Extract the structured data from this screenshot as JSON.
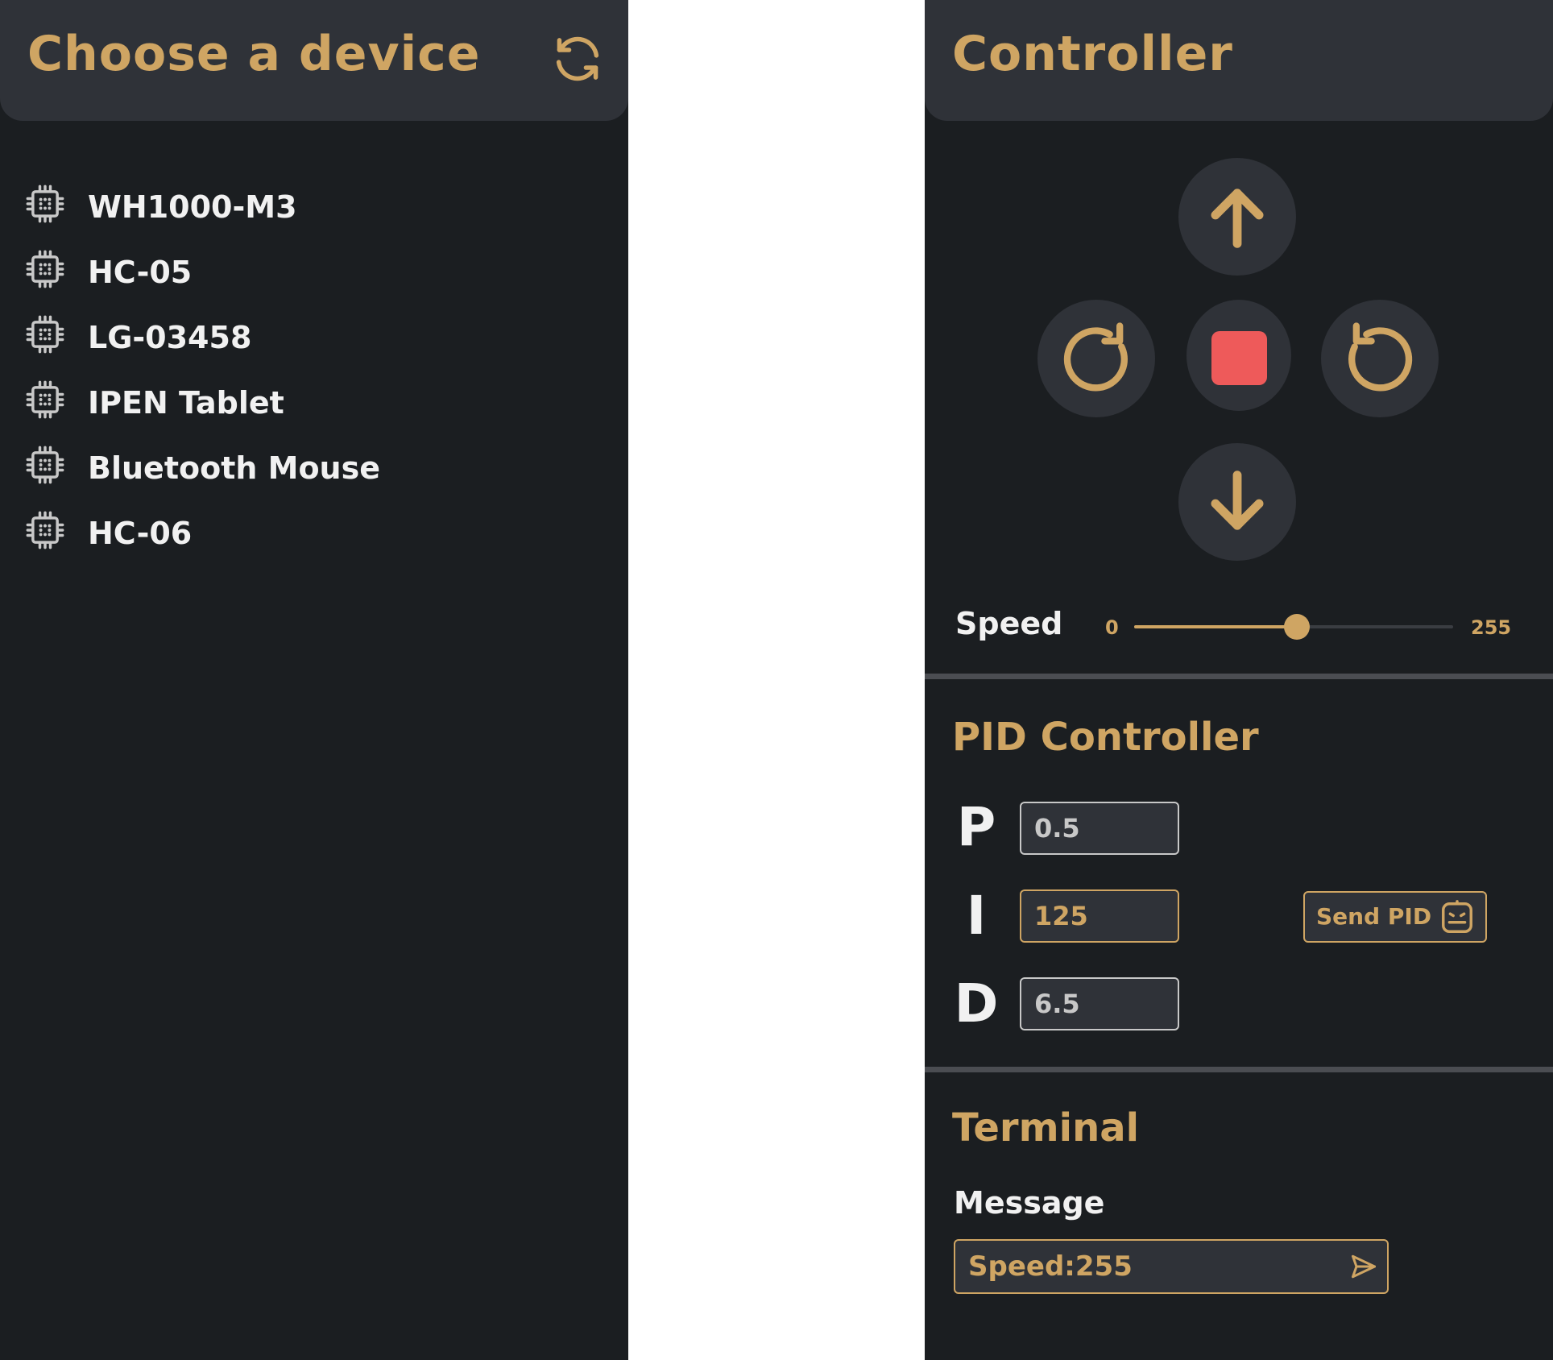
{
  "devices_panel": {
    "title": "Choose a device",
    "refresh_icon": "refresh-icon",
    "devices": [
      {
        "label": "WH1000-M3",
        "icon": "chip-icon"
      },
      {
        "label": "HC-05",
        "icon": "chip-icon"
      },
      {
        "label": "LG-03458",
        "icon": "chip-icon"
      },
      {
        "label": "IPEN Tablet",
        "icon": "chip-icon"
      },
      {
        "label": "Bluetooth Mouse",
        "icon": "chip-icon"
      },
      {
        "label": "HC-06",
        "icon": "chip-icon"
      }
    ]
  },
  "controller_panel": {
    "title": "Controller",
    "buttons": {
      "up": "arrow-up-icon",
      "rotate_cw": "rotate-clockwise-icon",
      "stop": "stop-icon",
      "rotate_ccw": "rotate-counterclockwise-icon",
      "down": "arrow-down-icon"
    },
    "speed": {
      "label": "Speed",
      "min": "0",
      "max": "255",
      "value": 130
    },
    "pid": {
      "title": "PID Controller",
      "p_label": "P",
      "p_value": "0.5",
      "i_label": "I",
      "i_value": "125",
      "d_label": "D",
      "d_value": "6.5",
      "send_label": "Send PID",
      "send_icon": "robot-face-icon"
    },
    "terminal": {
      "title": "Terminal",
      "message_label": "Message",
      "message_value": "Speed:255",
      "send_icon": "send-icon"
    }
  },
  "colors": {
    "accent": "#cfa563",
    "panel_bg": "#1b1e21",
    "header_bg": "#2f3238",
    "stop": "#ee5a5a",
    "text": "#f1f1f1"
  }
}
